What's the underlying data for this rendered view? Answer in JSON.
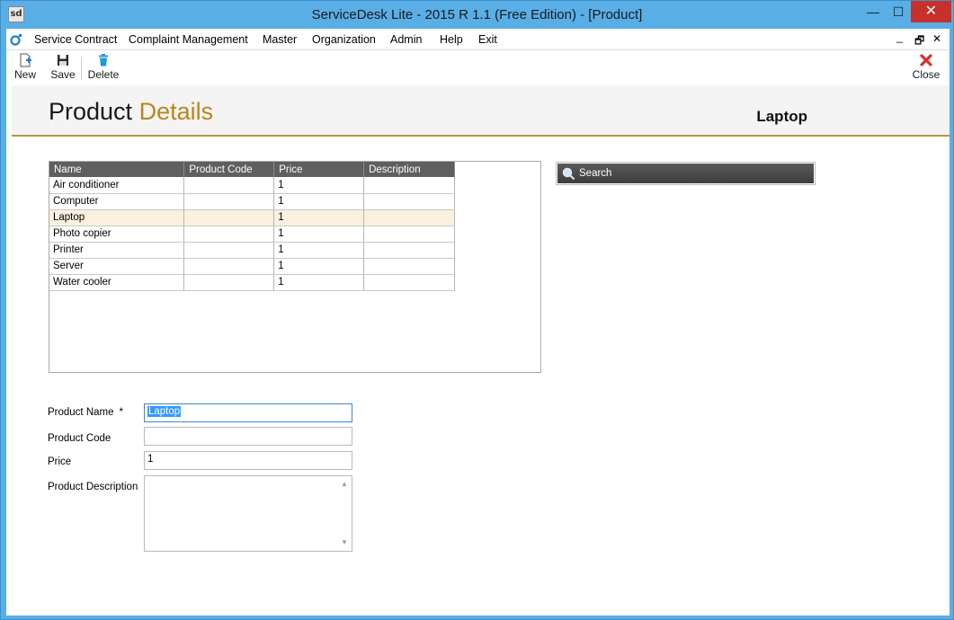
{
  "window": {
    "app_icon_label": "sd",
    "title": "ServiceDesk Lite - 2015 R 1.1 (Free Edition) - [Product]",
    "minimize_glyph": "—",
    "maximize_glyph": "☐",
    "close_glyph": "✕"
  },
  "menu": {
    "items": [
      "Service Contract",
      "Complaint Management",
      "Master",
      "Organization",
      "Admin",
      "Help",
      "Exit"
    ],
    "mdi_min": "_",
    "mdi_restore": "🗗",
    "mdi_close": "✕"
  },
  "toolbar": {
    "new_label": "New",
    "save_label": "Save",
    "delete_label": "Delete",
    "close_label": "Close"
  },
  "header": {
    "title_main": "Product",
    "title_accent": "Details",
    "current_record": "Laptop"
  },
  "grid": {
    "columns": [
      "Name",
      "Product Code",
      "Price",
      "Description"
    ],
    "rows": [
      {
        "name": "Air conditioner",
        "code": "",
        "price": "1",
        "description": ""
      },
      {
        "name": "Computer",
        "code": "",
        "price": "1",
        "description": ""
      },
      {
        "name": "Laptop",
        "code": "",
        "price": "1",
        "description": ""
      },
      {
        "name": "Photo copier",
        "code": "",
        "price": "1",
        "description": ""
      },
      {
        "name": "Printer",
        "code": "",
        "price": "1",
        "description": ""
      },
      {
        "name": "Server",
        "code": "",
        "price": "1",
        "description": ""
      },
      {
        "name": "Water cooler",
        "code": "",
        "price": "1",
        "description": ""
      }
    ],
    "selected_row": 2
  },
  "search": {
    "label": "Search"
  },
  "form": {
    "product_name_label": "Product Name",
    "required_marker": "*",
    "product_name_value": "Laptop",
    "product_code_label": "Product Code",
    "product_code_value": "",
    "price_label": "Price",
    "price_value": "1",
    "description_label": "Product Description",
    "description_value": ""
  },
  "colors": {
    "accent_gold": "#b8861a",
    "title_bar": "#5aaee6",
    "close_red": "#c7302b",
    "grid_header": "#5f5f5f",
    "selected_row": "#fbf0df"
  }
}
